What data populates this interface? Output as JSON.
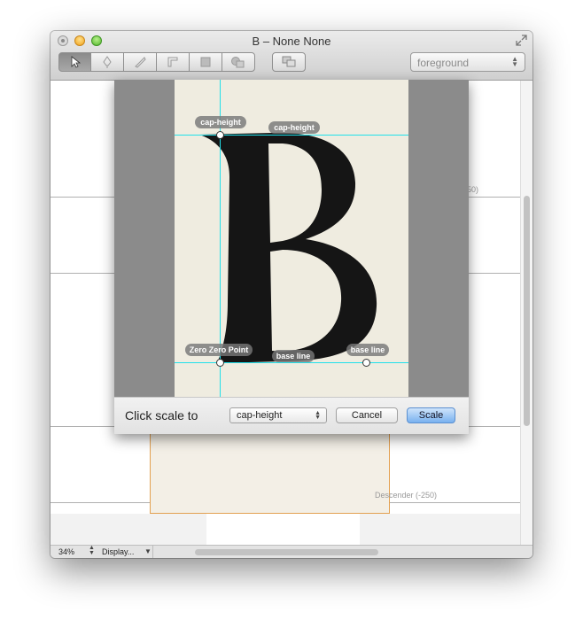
{
  "window": {
    "title": "B – None None"
  },
  "toolbar": {
    "tools": [
      "pointer-tool",
      "pen-tool",
      "knife-tool",
      "ruler-tool",
      "rectangle-tool",
      "shape-tool",
      "layers-tool"
    ],
    "layer_select": {
      "value": "foreground"
    }
  },
  "canvas": {
    "labels": {
      "cap_right": "50)",
      "descender": "Descender (-250)"
    }
  },
  "sheet": {
    "labels": {
      "cap_height_handle": "cap-height",
      "cap_height_line": "cap-height",
      "zero_point": "Zero Zero Point",
      "baseline_line": "base line",
      "baseline_handle": "base line"
    },
    "prompt": "Click scale to",
    "popup_value": "cap-height",
    "cancel_label": "Cancel",
    "scale_label": "Scale"
  },
  "status": {
    "zoom": "34%",
    "display": "Display..."
  },
  "colors": {
    "guide": "#21e0ea",
    "accent": "#79b1ef",
    "glyph_box_border": "#e3a050"
  }
}
